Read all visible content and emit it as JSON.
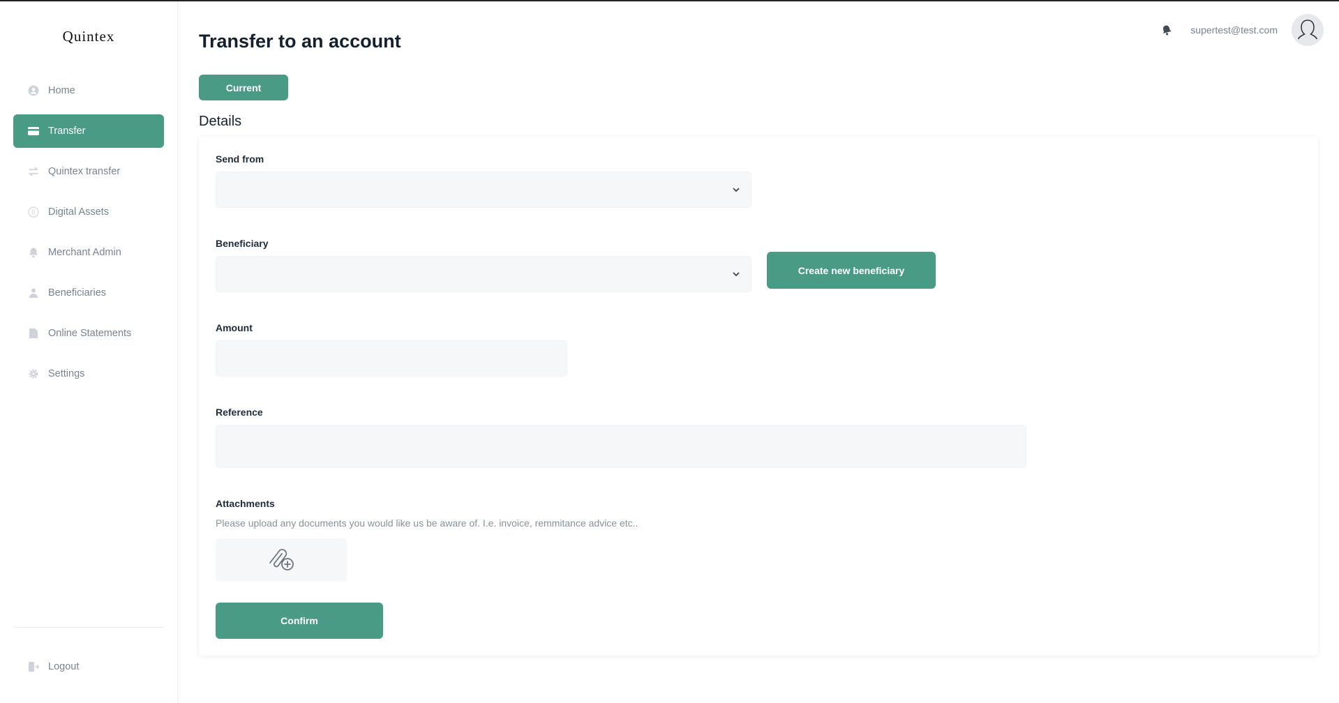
{
  "app": {
    "logo": "Quintex"
  },
  "sidebar": {
    "items": [
      {
        "label": "Home",
        "icon": "home-icon"
      },
      {
        "label": "Transfer",
        "icon": "card-icon",
        "active": true
      },
      {
        "label": "Quintex transfer",
        "icon": "arrows-exchange-icon"
      },
      {
        "label": "Digital Assets",
        "icon": "bitcoin-icon"
      },
      {
        "label": "Merchant Admin",
        "icon": "bell-icon"
      },
      {
        "label": "Beneficiaries",
        "icon": "users-icon"
      },
      {
        "label": "Online Statements",
        "icon": "document-icon"
      },
      {
        "label": "Settings",
        "icon": "gear-icon"
      }
    ],
    "logout": {
      "label": "Logout",
      "icon": "logout-icon"
    }
  },
  "header": {
    "title": "Transfer to an account",
    "email": "supertest@test.com"
  },
  "tabs": {
    "current": "Current"
  },
  "details": {
    "title": "Details",
    "send_from": {
      "label": "Send from",
      "value": ""
    },
    "beneficiary": {
      "label": "Beneficiary",
      "value": "",
      "create_button": "Create new beneficiary"
    },
    "amount": {
      "label": "Amount",
      "value": ""
    },
    "reference": {
      "label": "Reference",
      "value": ""
    },
    "attachments": {
      "label": "Attachments",
      "help": "Please upload any documents you would like us be aware of. I.e. invoice, remmitance advice etc.."
    },
    "confirm": "Confirm"
  },
  "colors": {
    "accent": "#4a9b85",
    "field_bg": "#f6f7f9",
    "muted_text": "#7a8290"
  }
}
